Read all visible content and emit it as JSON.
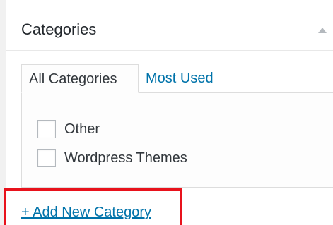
{
  "widget": {
    "title": "Categories",
    "collapse_icon": "triangle-up-icon"
  },
  "tabs": [
    {
      "label": "All Categories",
      "active": true
    },
    {
      "label": "Most Used",
      "active": false
    }
  ],
  "categories": [
    {
      "label": "Other",
      "checked": false
    },
    {
      "label": "Wordpress Themes",
      "checked": false
    }
  ],
  "add_new": {
    "label": "+ Add New Category"
  },
  "colors": {
    "link": "#0073aa",
    "highlight_border": "#e8121c"
  }
}
